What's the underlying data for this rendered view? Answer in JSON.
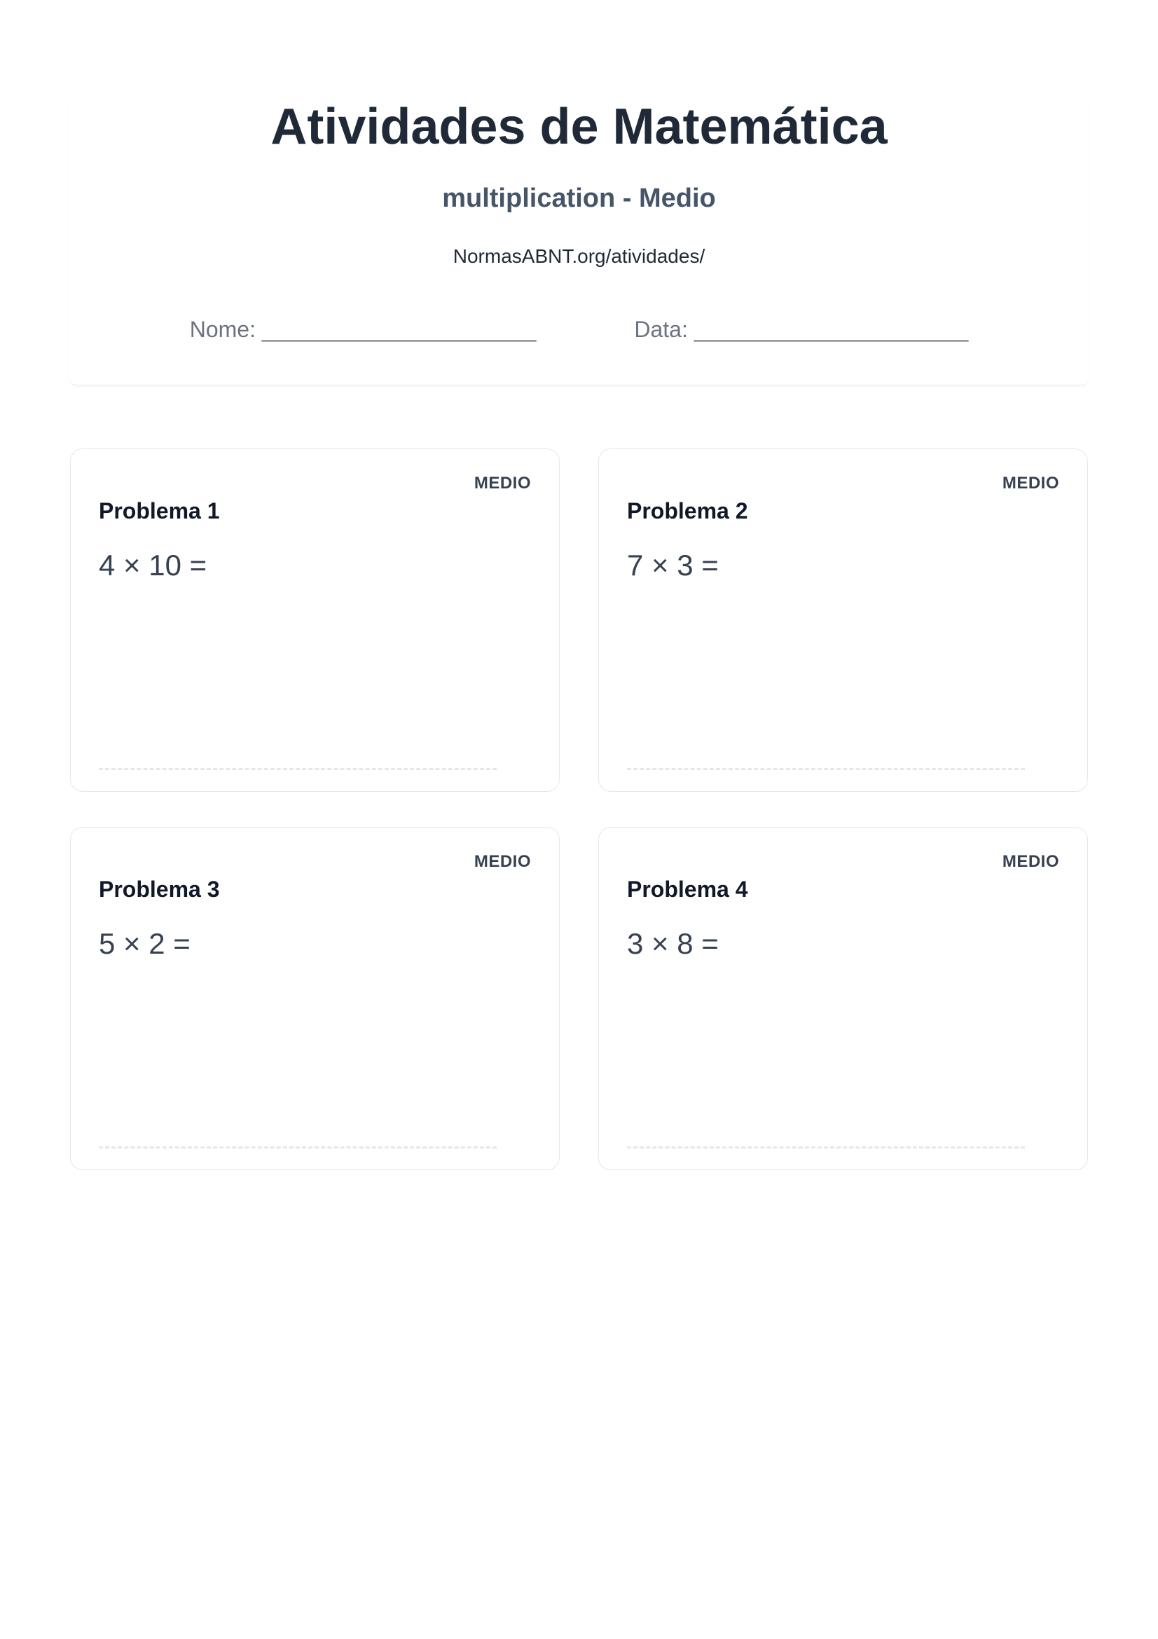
{
  "header": {
    "title": "Atividades de Matemática",
    "subtitle": "multiplication - Medio",
    "source": "NormasABNT.org/atividades/",
    "name_field": "Nome: ______________________",
    "date_field": "Data: ______________________"
  },
  "problems": [
    {
      "label": "Problema 1",
      "difficulty": "MEDIO",
      "expression": "4 × 10 ="
    },
    {
      "label": "Problema 2",
      "difficulty": "MEDIO",
      "expression": "7 × 3 ="
    },
    {
      "label": "Problema 3",
      "difficulty": "MEDIO",
      "expression": "5 × 2 ="
    },
    {
      "label": "Problema 4",
      "difficulty": "MEDIO",
      "expression": "3 × 8 ="
    }
  ]
}
